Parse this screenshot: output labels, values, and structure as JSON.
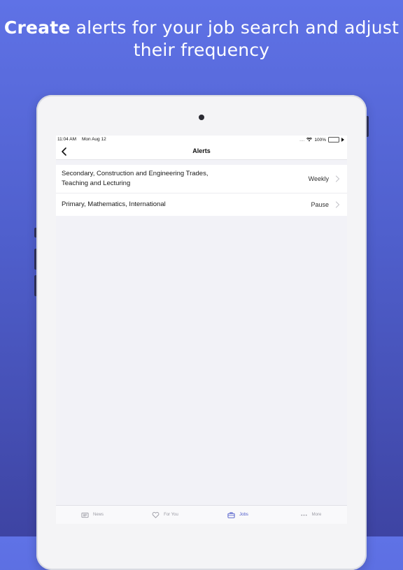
{
  "headline": {
    "bold": "Create",
    "rest_line1": " alerts for your job search and adjust",
    "line2": "their frequency"
  },
  "status_bar": {
    "time": "11:04 AM",
    "date": "Mon Aug 12",
    "signal": "....",
    "battery": "100%"
  },
  "nav": {
    "title": "Alerts"
  },
  "alerts": [
    {
      "line1": "Secondary, Construction and Engineering Trades,",
      "line2": "Teaching and Lecturing",
      "frequency": "Weekly"
    },
    {
      "line1": "Primary, Mathematics, International",
      "line2": "",
      "frequency": "Pause"
    }
  ],
  "tabs": [
    {
      "label": "News",
      "icon": "newspaper-icon"
    },
    {
      "label": "For You",
      "icon": "heart-icon"
    },
    {
      "label": "Jobs",
      "icon": "briefcase-icon",
      "active": true
    },
    {
      "label": "More",
      "icon": "more-dots-icon"
    }
  ],
  "colors": {
    "background_top": "#5f72e6",
    "background_bottom": "#3e44a3",
    "accent": "#4a57c8"
  }
}
